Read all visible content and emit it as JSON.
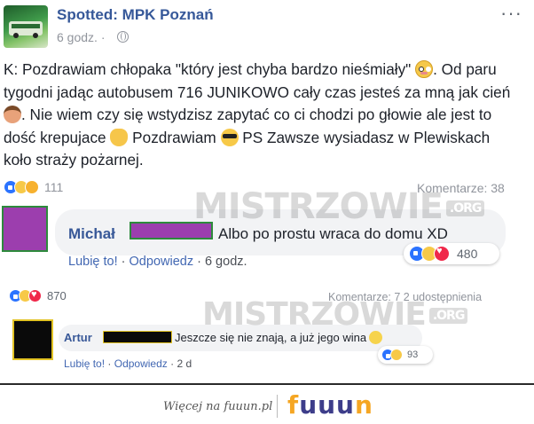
{
  "post": {
    "page_name": "Spotted: MPK Poznań",
    "time": "6 godz. ·",
    "more": "···",
    "body": {
      "part1": "K: Pozdrawiam chłopaka \"który jest chyba bardzo nieśmiały\" ",
      "part2": ". Od paru tygodni jadąc autobusem 716 JUNIKOWO cały czas jesteś za mną jak cień ",
      "part3": ". Nie wiem czy się wstydzisz zapytać co ci chodzi po głowie ale jest to dość krepujace ",
      "part4": " Pozdrawiam ",
      "part5": " PS Zawsze wysiadasz w Plewiskach koło straży pożarnej."
    },
    "reactions_count": "111",
    "comments_count": "Komentarze: 38",
    "comment": {
      "author": "Michał",
      "text": "Albo po prostu wraca do domu XD",
      "like": "Lubię to!",
      "reply": "Odpowiedz",
      "time": "· 6 godz.",
      "reactions_count": "480"
    }
  },
  "post2": {
    "reactions_count": "870",
    "meta": "Komentarze: 7  2 udostępnienia",
    "comment": {
      "author": "Artur",
      "text": "Jeszcze się nie znają, a już jego wina",
      "like": "Lubię to!",
      "reply": "Odpowiedz",
      "time": "· 2 d",
      "reactions_count": "93"
    }
  },
  "watermark": {
    "text": "MISTRZOWIE",
    "suffix": ".ORG"
  },
  "footer": {
    "text": "Więcej na fuuun.pl",
    "brand": [
      "f",
      "uuu",
      "n"
    ]
  },
  "colors": {
    "link": "#365899",
    "brand_orange": "#f5a623",
    "brand_navy": "#3d3d8a"
  }
}
